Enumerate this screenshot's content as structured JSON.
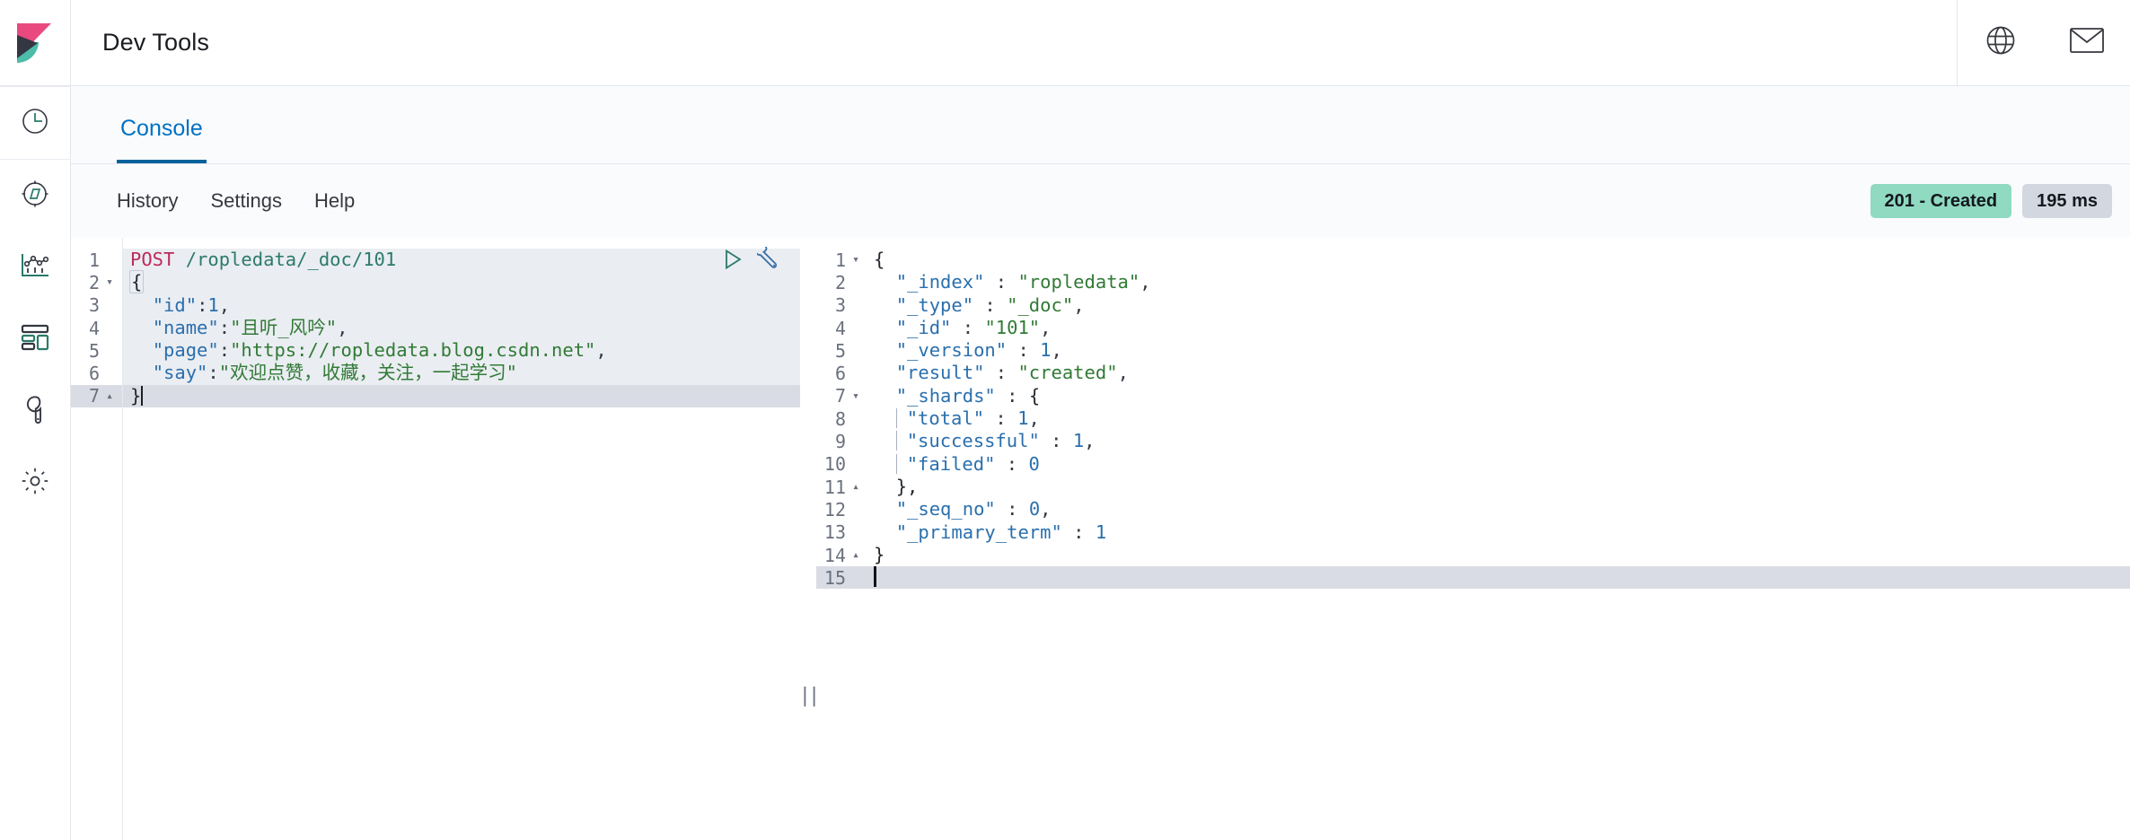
{
  "header": {
    "title": "Dev Tools",
    "logo_icon": "kibana-logo-icon",
    "right_icons": [
      {
        "name": "help-globe-icon",
        "label": "Help"
      },
      {
        "name": "mail-envelope-icon",
        "label": "News"
      }
    ]
  },
  "sidebar": {
    "items": [
      {
        "name": "sidebar-item-recently-viewed",
        "icon": "clock-icon",
        "label": "Recently viewed"
      },
      {
        "name": "sidebar-item-discover",
        "icon": "compass-icon",
        "label": "Discover"
      },
      {
        "name": "sidebar-item-visualize",
        "icon": "bar-chart-icon",
        "label": "Visualize"
      },
      {
        "name": "sidebar-item-dashboard",
        "icon": "dashboard-grid-icon",
        "label": "Dashboard"
      },
      {
        "name": "sidebar-item-dev-tools",
        "icon": "wrench-icon",
        "label": "Dev Tools"
      },
      {
        "name": "sidebar-item-management",
        "icon": "gear-icon",
        "label": "Management"
      }
    ]
  },
  "tabs": [
    {
      "name": "tab-console",
      "label": "Console",
      "active": true
    }
  ],
  "toolbar": {
    "links": [
      {
        "name": "history-link",
        "label": "History"
      },
      {
        "name": "settings-link",
        "label": "Settings"
      },
      {
        "name": "help-link",
        "label": "Help"
      }
    ],
    "status_badge": "201 - Created",
    "time_badge": "195 ms"
  },
  "request_editor": {
    "run_icon": "play-triangle-icon",
    "wrench_icon": "wrench-icon",
    "lines": [
      {
        "num": "1",
        "fold": "none",
        "highlight": "body"
      },
      {
        "num": "2",
        "fold": "down",
        "highlight": "body"
      },
      {
        "num": "3",
        "fold": "none",
        "highlight": "body"
      },
      {
        "num": "4",
        "fold": "none",
        "highlight": "body"
      },
      {
        "num": "5",
        "fold": "none",
        "highlight": "body"
      },
      {
        "num": "6",
        "fold": "none",
        "highlight": "body"
      },
      {
        "num": "7",
        "fold": "up",
        "highlight": "cursor"
      }
    ],
    "text": {
      "l1_method": "POST",
      "l1_url": "/ropledata/_doc/101",
      "l2": "{",
      "l3_key": "\"id\"",
      "l3_val": "1",
      "l4_key": "\"name\"",
      "l4_val": "\"且听_风吟\"",
      "l5_key": "\"page\"",
      "l5_val": "\"https://ropledata.blog.csdn.net\"",
      "l6_key": "\"say\"",
      "l6_val": "\"欢迎点赞，收藏，关注，一起学习\"",
      "l7": "}"
    }
  },
  "response_editor": {
    "lines": [
      {
        "num": "1",
        "fold": "down"
      },
      {
        "num": "2",
        "fold": "none"
      },
      {
        "num": "3",
        "fold": "none"
      },
      {
        "num": "4",
        "fold": "none"
      },
      {
        "num": "5",
        "fold": "none"
      },
      {
        "num": "6",
        "fold": "none"
      },
      {
        "num": "7",
        "fold": "down"
      },
      {
        "num": "8",
        "fold": "none"
      },
      {
        "num": "9",
        "fold": "none"
      },
      {
        "num": "10",
        "fold": "none"
      },
      {
        "num": "11",
        "fold": "up"
      },
      {
        "num": "12",
        "fold": "none"
      },
      {
        "num": "13",
        "fold": "none"
      },
      {
        "num": "14",
        "fold": "up"
      },
      {
        "num": "15",
        "fold": "none",
        "highlight": "cursor"
      }
    ],
    "text": {
      "l1": "{",
      "l2_key": "\"_index\"",
      "l2_val": "\"ropledata\"",
      "l3_key": "\"_type\"",
      "l3_val": "\"_doc\"",
      "l4_key": "\"_id\"",
      "l4_val": "\"101\"",
      "l5_key": "\"_version\"",
      "l5_val": "1",
      "l6_key": "\"result\"",
      "l6_val": "\"created\"",
      "l7_key": "\"_shards\"",
      "l7_val": "{",
      "l8_key": "\"total\"",
      "l8_val": "1",
      "l9_key": "\"successful\"",
      "l9_val": "1",
      "l10_key": "\"failed\"",
      "l10_val": "0",
      "l11": "},",
      "l12_key": "\"_seq_no\"",
      "l12_val": "0",
      "l13_key": "\"_primary_term\"",
      "l13_val": "1",
      "l14": "}",
      "l15": ""
    }
  },
  "colors": {
    "accent_blue": "#0071c2",
    "tab_underline": "#07629c",
    "badge_success_bg": "#8fdac0",
    "badge_time_bg": "#d3d7e0",
    "method_pink": "#bd2a58",
    "url_teal": "#2b7a6b",
    "key_blue": "#2a6fad",
    "string_green": "#317a36",
    "logo_pink": "#e9497f",
    "logo_teal": "#4cbcab",
    "logo_dark": "#343741"
  }
}
